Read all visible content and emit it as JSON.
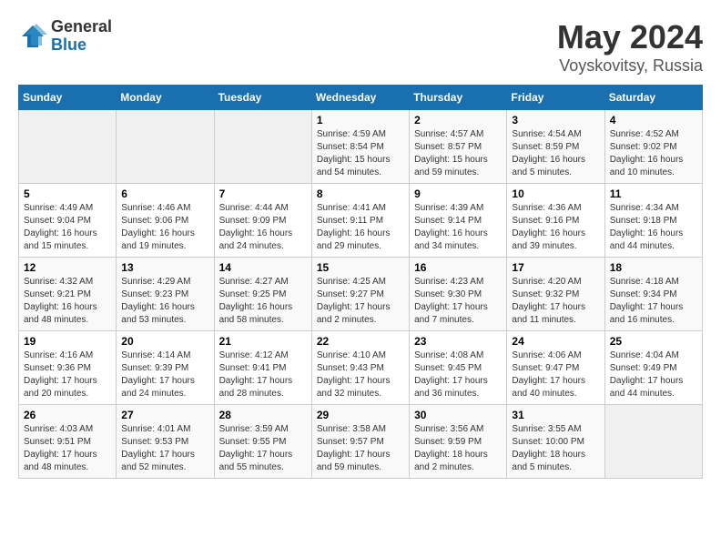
{
  "logo": {
    "general": "General",
    "blue": "Blue"
  },
  "title": "May 2024",
  "subtitle": "Voyskovitsy, Russia",
  "days_header": [
    "Sunday",
    "Monday",
    "Tuesday",
    "Wednesday",
    "Thursday",
    "Friday",
    "Saturday"
  ],
  "weeks": [
    [
      {
        "day": "",
        "info": ""
      },
      {
        "day": "",
        "info": ""
      },
      {
        "day": "",
        "info": ""
      },
      {
        "day": "1",
        "info": "Sunrise: 4:59 AM\nSunset: 8:54 PM\nDaylight: 15 hours\nand 54 minutes."
      },
      {
        "day": "2",
        "info": "Sunrise: 4:57 AM\nSunset: 8:57 PM\nDaylight: 15 hours\nand 59 minutes."
      },
      {
        "day": "3",
        "info": "Sunrise: 4:54 AM\nSunset: 8:59 PM\nDaylight: 16 hours\nand 5 minutes."
      },
      {
        "day": "4",
        "info": "Sunrise: 4:52 AM\nSunset: 9:02 PM\nDaylight: 16 hours\nand 10 minutes."
      }
    ],
    [
      {
        "day": "5",
        "info": "Sunrise: 4:49 AM\nSunset: 9:04 PM\nDaylight: 16 hours\nand 15 minutes."
      },
      {
        "day": "6",
        "info": "Sunrise: 4:46 AM\nSunset: 9:06 PM\nDaylight: 16 hours\nand 19 minutes."
      },
      {
        "day": "7",
        "info": "Sunrise: 4:44 AM\nSunset: 9:09 PM\nDaylight: 16 hours\nand 24 minutes."
      },
      {
        "day": "8",
        "info": "Sunrise: 4:41 AM\nSunset: 9:11 PM\nDaylight: 16 hours\nand 29 minutes."
      },
      {
        "day": "9",
        "info": "Sunrise: 4:39 AM\nSunset: 9:14 PM\nDaylight: 16 hours\nand 34 minutes."
      },
      {
        "day": "10",
        "info": "Sunrise: 4:36 AM\nSunset: 9:16 PM\nDaylight: 16 hours\nand 39 minutes."
      },
      {
        "day": "11",
        "info": "Sunrise: 4:34 AM\nSunset: 9:18 PM\nDaylight: 16 hours\nand 44 minutes."
      }
    ],
    [
      {
        "day": "12",
        "info": "Sunrise: 4:32 AM\nSunset: 9:21 PM\nDaylight: 16 hours\nand 48 minutes."
      },
      {
        "day": "13",
        "info": "Sunrise: 4:29 AM\nSunset: 9:23 PM\nDaylight: 16 hours\nand 53 minutes."
      },
      {
        "day": "14",
        "info": "Sunrise: 4:27 AM\nSunset: 9:25 PM\nDaylight: 16 hours\nand 58 minutes."
      },
      {
        "day": "15",
        "info": "Sunrise: 4:25 AM\nSunset: 9:27 PM\nDaylight: 17 hours\nand 2 minutes."
      },
      {
        "day": "16",
        "info": "Sunrise: 4:23 AM\nSunset: 9:30 PM\nDaylight: 17 hours\nand 7 minutes."
      },
      {
        "day": "17",
        "info": "Sunrise: 4:20 AM\nSunset: 9:32 PM\nDaylight: 17 hours\nand 11 minutes."
      },
      {
        "day": "18",
        "info": "Sunrise: 4:18 AM\nSunset: 9:34 PM\nDaylight: 17 hours\nand 16 minutes."
      }
    ],
    [
      {
        "day": "19",
        "info": "Sunrise: 4:16 AM\nSunset: 9:36 PM\nDaylight: 17 hours\nand 20 minutes."
      },
      {
        "day": "20",
        "info": "Sunrise: 4:14 AM\nSunset: 9:39 PM\nDaylight: 17 hours\nand 24 minutes."
      },
      {
        "day": "21",
        "info": "Sunrise: 4:12 AM\nSunset: 9:41 PM\nDaylight: 17 hours\nand 28 minutes."
      },
      {
        "day": "22",
        "info": "Sunrise: 4:10 AM\nSunset: 9:43 PM\nDaylight: 17 hours\nand 32 minutes."
      },
      {
        "day": "23",
        "info": "Sunrise: 4:08 AM\nSunset: 9:45 PM\nDaylight: 17 hours\nand 36 minutes."
      },
      {
        "day": "24",
        "info": "Sunrise: 4:06 AM\nSunset: 9:47 PM\nDaylight: 17 hours\nand 40 minutes."
      },
      {
        "day": "25",
        "info": "Sunrise: 4:04 AM\nSunset: 9:49 PM\nDaylight: 17 hours\nand 44 minutes."
      }
    ],
    [
      {
        "day": "26",
        "info": "Sunrise: 4:03 AM\nSunset: 9:51 PM\nDaylight: 17 hours\nand 48 minutes."
      },
      {
        "day": "27",
        "info": "Sunrise: 4:01 AM\nSunset: 9:53 PM\nDaylight: 17 hours\nand 52 minutes."
      },
      {
        "day": "28",
        "info": "Sunrise: 3:59 AM\nSunset: 9:55 PM\nDaylight: 17 hours\nand 55 minutes."
      },
      {
        "day": "29",
        "info": "Sunrise: 3:58 AM\nSunset: 9:57 PM\nDaylight: 17 hours\nand 59 minutes."
      },
      {
        "day": "30",
        "info": "Sunrise: 3:56 AM\nSunset: 9:59 PM\nDaylight: 18 hours\nand 2 minutes."
      },
      {
        "day": "31",
        "info": "Sunrise: 3:55 AM\nSunset: 10:00 PM\nDaylight: 18 hours\nand 5 minutes."
      },
      {
        "day": "",
        "info": ""
      }
    ]
  ]
}
